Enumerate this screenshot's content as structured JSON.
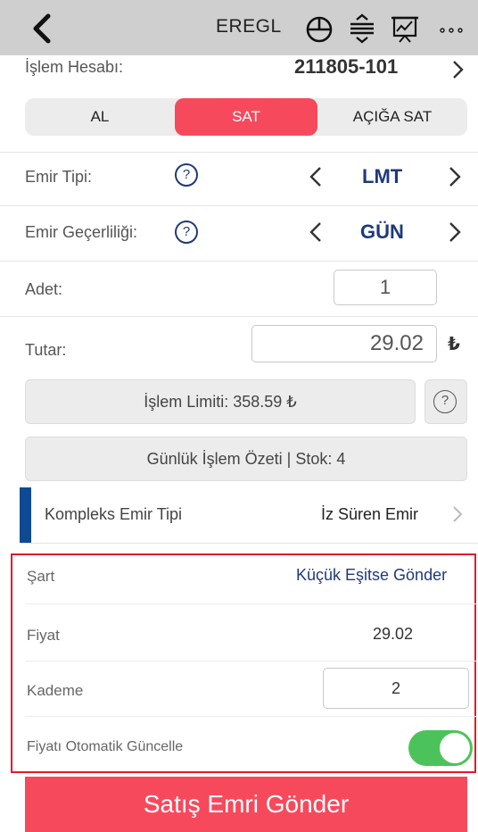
{
  "header": {
    "symbol": "EREGL",
    "icons": [
      "back-icon",
      "pie-chart-icon",
      "sort-icon",
      "presentation-chart-icon",
      "more-icon"
    ]
  },
  "account": {
    "label": "İşlem Hesabı:",
    "value": "211805-101"
  },
  "segments": {
    "buy": "AL",
    "sell": "SAT",
    "short": "AÇIĞA SAT",
    "active": "sell"
  },
  "order_type": {
    "label": "Emir Tipi:",
    "value": "LMT",
    "help": "?"
  },
  "validity": {
    "label": "Emir Geçerliliği:",
    "value": "GÜN",
    "help": "?"
  },
  "quantity": {
    "label": "Adet:",
    "value": "1"
  },
  "amount": {
    "label": "Tutar:",
    "value": "29.02",
    "currency": "₺"
  },
  "limit": {
    "label": "İşlem Limiti: 358.59 ₺",
    "help": "?"
  },
  "summary": {
    "label": "Günlük İşlem Özeti | Stok: 4"
  },
  "complex": {
    "label": "Kompleks Emir Tipi",
    "value": "İz Süren Emir"
  },
  "condition_panel": {
    "condition_label": "Şart",
    "condition_value": "Küçük Eşitse Gönder",
    "price_label": "Fiyat",
    "price_value": "29.02",
    "step_label": "Kademe",
    "step_value": "2",
    "auto_update_label": "Fiyatı Otomatik Güncelle",
    "auto_update_on": true
  },
  "submit": {
    "label": "Satış Emri Gönder"
  },
  "colors": {
    "accent_red": "#f64a5c",
    "navy": "#1f3a7a",
    "complex_bar": "#0d4a94",
    "toggle_on": "#4cc35a",
    "highlight_border": "#e21a2a"
  }
}
